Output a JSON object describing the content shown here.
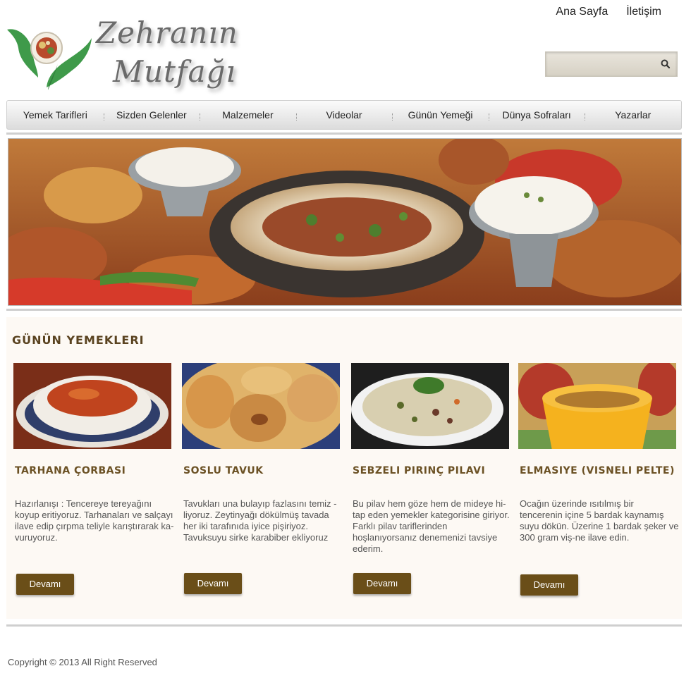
{
  "site": {
    "logo_line1": "Zehranın",
    "logo_line2": "Mutfağı"
  },
  "top_nav": [
    "Ana Sayfa",
    "İletişim"
  ],
  "search": {
    "placeholder": "",
    "icon": "search-icon"
  },
  "main_nav": [
    "Yemek Tarifleri",
    "Sizden Gelenler",
    "Malzemeler",
    "Videolar",
    "Günün Yemeği",
    "Dünya Sofraları",
    "Yazarlar"
  ],
  "section_title": "GÜNÜN YEMEKLERI",
  "cards": [
    {
      "title": "TARHANA ÇORBASI",
      "desc": "Hazırlanışı : Tencereye tereyağını koyup eritiyoruz. Tarhanaları ve salçayı ilave edip çırpma teliyle karıştırarak ka-vuruyoruz.",
      "button": "Devamı"
    },
    {
      "title": "SOSLU TAVUK",
      "desc": "Tavukları una bulayıp fazlasını temiz - liyoruz. Zeytinyağı dökülmüş tavada her iki tarafınıda iyice pişiriyoz. Tavuksuyu sirke karabiber ekliyoruz",
      "button": "Devamı"
    },
    {
      "title": "SEBZELI PIRINÇ PILAVI",
      "desc": "Bu pilav hem göze hem de mideye hi-tap eden yemekler kategorisine giriyor. Farklı pilav tariflerinden hoşlanıyorsanız denemenizi tavsiye ederim.",
      "button": "Devamı"
    },
    {
      "title": "ELMASIYE (VISNELI PELTE)",
      "desc": "Ocağın üzerinde ısıtılmış bir tencerenin içine 5 bardak kaynamış suyu dökün. Üzerine 1 bardak şeker ve 300 gram viş-ne ilave edin.",
      "button": "Devamı"
    }
  ],
  "footer": "Copyright © 2013 All Right Reserved",
  "colors": {
    "accent": "#6a4e18",
    "title": "#5a4320",
    "panel": "#fdf9f4"
  }
}
